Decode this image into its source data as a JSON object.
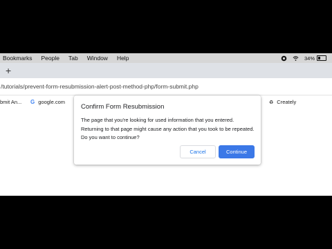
{
  "menubar": {
    "items": [
      "Bookmarks",
      "People",
      "Tab",
      "Window",
      "Help"
    ],
    "battery_text": "34%"
  },
  "tabstrip": {
    "new_tab_label": "+"
  },
  "address": {
    "url": "/tutorials/prevent-form-resubmission-alert-post-method-php/form-submit.php"
  },
  "bookmarks": {
    "items": [
      {
        "label": "bmit An...",
        "icon": "bookmark-icon"
      },
      {
        "label": "google.com",
        "icon": "google-icon"
      },
      {
        "label": "Creately",
        "icon": "creately-icon"
      }
    ]
  },
  "dialog": {
    "title": "Confirm Form Resubmission",
    "body": "The page that you're looking for used information that you entered. Returning to that page might cause any action that you took to be repeated. Do you want to continue?",
    "cancel_label": "Cancel",
    "continue_label": "Continue"
  }
}
